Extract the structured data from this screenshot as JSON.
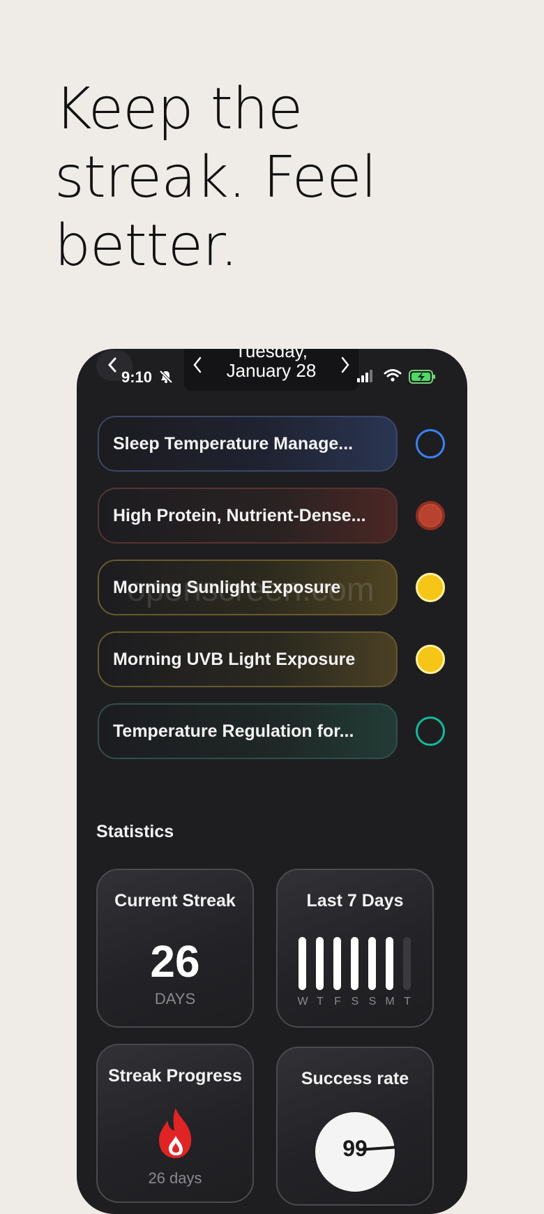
{
  "headline": {
    "lines": [
      "Keep the",
      "streak. Feel",
      "better."
    ]
  },
  "status_bar": {
    "time": "9:10",
    "date_top": "Tuesday,",
    "date_bottom": "January 28"
  },
  "habits": [
    {
      "label": "Sleep Temperature Manage...",
      "color": "#3b82f6",
      "completed": false
    },
    {
      "label": "High Protein, Nutrient-Dense...",
      "color": "#b8412f",
      "completed": true
    },
    {
      "label": "Morning Sunlight Exposure",
      "color": "#f5c518",
      "completed": true
    },
    {
      "label": "Morning UVB Light Exposure",
      "color": "#f5c518",
      "completed": true
    },
    {
      "label": "Temperature Regulation for...",
      "color": "#14b89a",
      "completed": false
    }
  ],
  "watermark": "openscreen.com",
  "statistics": {
    "title": "Statistics",
    "current_streak": {
      "title": "Current Streak",
      "value": "26",
      "unit": "DAYS"
    },
    "last_7_days": {
      "title": "Last 7 Days",
      "days": [
        "W",
        "T",
        "F",
        "S",
        "S",
        "M",
        "T"
      ],
      "completed": [
        true,
        true,
        true,
        true,
        true,
        true,
        false
      ]
    },
    "streak_progress": {
      "title": "Streak Progress",
      "subtitle": "26 days"
    },
    "success_rate": {
      "title": "Success rate",
      "value": "99"
    }
  },
  "colors": {
    "background": "#efece8",
    "phone": "#1e1e21",
    "flame": "#e02424",
    "bar_done": "#ffffff",
    "bar_empty": "#3a3a3e"
  }
}
